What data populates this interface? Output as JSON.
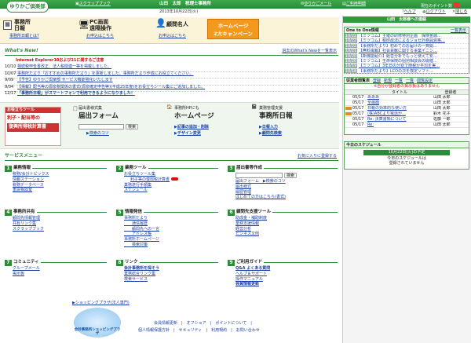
{
  "header": {
    "logo": "ゆりかご倶楽部",
    "scrap": "スクラップブック",
    "user": "山田　太郎　税理士事務所",
    "date": "2013年10月22日(火)",
    "mail": "ゆりかごメール",
    "mypage": "ご利用明細",
    "points": "現在のポイント数",
    "help": "ヘルプ",
    "logout": "ログアウト",
    "close": "閉じる"
  },
  "banners": {
    "b1_title": "事務所\n日報",
    "b1_sub": "事務所日報とは?",
    "b2_title": "PC画面\n遠隔操作",
    "b2_sub": "お申込はこちら",
    "b3_title": "顧問名人",
    "b3_sub": "お申込はこちら",
    "b4_line1": "ホームページ",
    "b4_line2": "2大キャンペーン"
  },
  "whatsnew": {
    "title": "What's New!",
    "past": "過去のWhat's Newを一覧表示",
    "headline": "Internet Explorer10および11に関するご注意",
    "items": [
      {
        "date": "10/10",
        "text": "相続税申告書改正、法人税関連一等を掲載しました。"
      },
      {
        "date": "10/07",
        "text": "事務所だより「おすすめの事務所だより」を更新しました。事務所だより作成にお役立てください。"
      },
      {
        "date": "9/09",
        "text": "【予告】ゆりかご倶楽部 サービス機能強化いたします"
      },
      {
        "date": "9/04",
        "text": "【掲載】配当等の源泉税関係の書式(源泉確定申告等)(平成25年度)をお役立ちシール集にご追加しました。"
      },
      {
        "date": "12/17",
        "text": "「事務所日報」がスマートフォンで利用できるようになりました！"
      }
    ]
  },
  "promo": {
    "left_title": "お役立ちツール",
    "left_l1": "利子・配当等の",
    "left_l2": "復興所得税計算書",
    "p1_head": "届出書様式集",
    "p1_title": "届出フォーム",
    "p1_search": "検索",
    "p1_link": "検索のコツ",
    "p2_head": "事務所HPにも",
    "p2_title": "ホームページ",
    "p2_l1": "記事の追加・削除",
    "p2_l2": "デザイン変更",
    "p3_head": "業務管理支援",
    "p3_title": "事務所日報",
    "p3_l1": "日報入力",
    "p3_l2": "顧問先検索"
  },
  "menu": {
    "title": "サービスメニュー",
    "hint": "お気に入りに登録する",
    "s1": {
      "n": "1",
      "label": "業務情報",
      "items": [
        "税務/会計トピックス",
        "情報ステーション",
        "税務データベース",
        "重説相談室",
        "自社活動"
      ]
    },
    "s2": {
      "n": "2",
      "label": "業務ツール",
      "items": [
        "お役立ちツール集",
        "利子等の復興税計算書",
        "業務遂行手順集",
        "スケジュール"
      ]
    },
    "s3": {
      "n": "3",
      "label": "届出書等作成",
      "search": "検索",
      "items": [
        "届出フォーム　▶検索のコツ",
        "届出様式",
        "履歴管理",
        "はじめての方はこちら(書式)"
      ]
    },
    "s4": {
      "n": "4",
      "label": "事務所共有",
      "items": [
        "顧問先情報管理",
        "共有リンク集",
        "スクラップブック"
      ]
    },
    "s5": {
      "n": "5",
      "label": "情報発信",
      "items": [
        "事務所だより",
        "　　通信履歴",
        "　　顧問先への一言",
        "　　アドレス帳",
        "事務所ホームページ",
        "　　検索対策"
      ]
    },
    "s6": {
      "n": "6",
      "label": "顧問先支援ツール",
      "items": [
        "助成金・補助制度",
        "業務支援情報",
        "経営分析",
        "ビジネス文例"
      ]
    },
    "s7": {
      "n": "7",
      "label": "コミュニティ",
      "items": [
        "グループメール",
        "掲示板"
      ]
    },
    "s8": {
      "n": "8",
      "label": "リンク",
      "items": [
        "会計事務所を探そう",
        "業務総合リンク集",
        "検索サービス"
      ]
    },
    "s9": {
      "n": "9",
      "label": "ご利用ガイド",
      "items": [
        "Q&A よくある質問",
        "ヘルプ＆サポート",
        "操作マニュアル",
        "会員情報更新"
      ]
    }
  },
  "footer": {
    "shop": "▶ショッピングプラザ(法人専門)",
    "shoplogo": "会計事務所ショッピングプラザ",
    "links1": "会員情報更新　|　オフショア　|　ポイントについて　|",
    "links2": "個人情報保護方針　|　セキュリティ　|　利用規約　|　お問い合わせ"
  },
  "right": {
    "office_bar": "山田　太郎様への連絡",
    "oto": {
      "title": "One to One情報",
      "more": "一覧表示",
      "items": [
        {
          "d": "10/22",
          "t": "【ミツコム】主催の研修特別企画　保険金融…"
        },
        {
          "d": "10/22",
          "t": "【ミツコム】税財政法によるジョセ外務員資格…"
        },
        {
          "d": "10/22",
          "t": "【事務所だより】初めてのお届けの一斉開…"
        },
        {
          "d": "10/21",
          "t": "【無料風報】社会貢献に関する事業イニシ…"
        },
        {
          "d": "10/20",
          "t": "【新機能紹介】経営分析でもっと使えて安…"
        },
        {
          "d": "10/20",
          "t": "【ミツコム】生命保険の個別相談会の開催…"
        },
        {
          "d": "10/19",
          "t": "【ミツコム】3年日の分割で節税か平均を実…"
        },
        {
          "d": "10/18",
          "t": "【事務所だより】LCOの次を検定ソフト..."
        }
      ]
    },
    "bbs": {
      "title": "従業者閲覧表",
      "btn1": "登録",
      "btn2": "新規",
      "btn3": "一覧",
      "btn4": "一覧",
      "btn5": "閲覧設定",
      "notice": "※自分が登録者の掲示板はありません",
      "col_date": "日付",
      "col_title": "タイトル",
      "col_owner": "登録者",
      "rows": [
        {
          "d": "05/17",
          "t": "あああ",
          "o": "山田 太郎",
          "m": false
        },
        {
          "d": "05/17",
          "t": "全画面",
          "o": "山田 太郎",
          "m": false
        },
        {
          "d": "05/17",
          "t": "日報の効率的な使い方",
          "o": "山田 太郎",
          "m": true
        },
        {
          "d": "05/17",
          "t": "(株)ABCより電話が...",
          "o": "鈴木 花子",
          "m": true
        },
        {
          "d": "05/17",
          "t": "Re: 決算書類について",
          "o": "佐藤 一郎",
          "m": false
        },
        {
          "d": "05/17",
          "t": "Re:",
          "o": "山田 太郎",
          "m": false
        }
      ]
    },
    "sched": {
      "title": "今日のスケジュール",
      "date": "10月22日(火)の予定",
      "msg1": "今日のスケジュールは",
      "msg2": "登録されていません"
    }
  },
  "colors": {
    "green": "#2e8b3a",
    "header": "#2f9a3c",
    "red": "#d21010",
    "link": "#1a3fa0",
    "orange": "#f7b52a"
  }
}
